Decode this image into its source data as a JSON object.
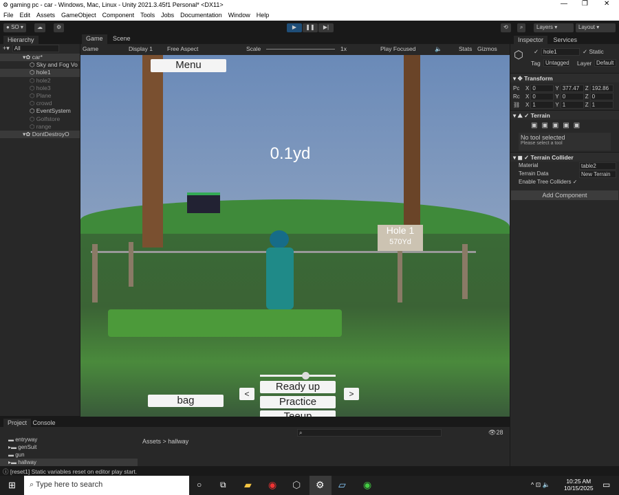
{
  "window": {
    "title": "gaming pc - car - Windows, Mac, Linux - Unity 2021.3.45f1 Personal* <DX11>",
    "controls": [
      "—",
      "❐",
      "✕"
    ]
  },
  "menu": [
    "File",
    "Edit",
    "Assets",
    "GameObject",
    "Component",
    "Tools",
    "Jobs",
    "Documentation",
    "Window",
    "Help"
  ],
  "toolbar": {
    "account": "SO",
    "layers": "Layers",
    "layout": "Layout"
  },
  "hierarchy": {
    "title": "Hierarchy",
    "search_placeholder": "All",
    "items": [
      {
        "label": "car*",
        "state": "scene"
      },
      {
        "label": "Sky and Fog Vo",
        "state": "normal"
      },
      {
        "label": "hole1",
        "state": "selected"
      },
      {
        "label": "hole2",
        "state": "inactive"
      },
      {
        "label": "hole3",
        "state": "inactive"
      },
      {
        "label": "Plane",
        "state": "inactive"
      },
      {
        "label": "crowd",
        "state": "inactive"
      },
      {
        "label": "EventSystem",
        "state": "normal"
      },
      {
        "label": "Golfstore",
        "state": "inactive"
      },
      {
        "label": "range",
        "state": "inactive"
      },
      {
        "label": "DontDestroyO",
        "state": "scene"
      }
    ]
  },
  "game_view": {
    "tabs": [
      "Game",
      "Scene"
    ],
    "mode": "Game",
    "display": "Display 1",
    "aspect": "Free Aspect",
    "scale_label": "Scale",
    "scale_value": "1x",
    "play_mode": "Play Focused",
    "stats": "Stats",
    "gizmos": "Gizmos"
  },
  "game_ui": {
    "menu_button": "Menu",
    "distance": "0.1yd",
    "sign_title": "Hole 1",
    "sign_yardage": "570Yd",
    "ready_button": "Ready up",
    "practice_button": "Practice",
    "teeup_button": "Teeup",
    "bag_button": "bag",
    "prev_button": "<",
    "next_button": ">",
    "power_slider": 0.6
  },
  "inspector": {
    "tabs": [
      "Inspector",
      "Services"
    ],
    "object_name": "hole1",
    "static_label": "Static",
    "tag_label": "Tag",
    "tag_value": "Untagged",
    "layer_label": "Layer",
    "layer_value": "Default",
    "transform": {
      "title": "Transform",
      "position": {
        "label": "Pc",
        "x": "0",
        "y": "377.47",
        "z": "192.86"
      },
      "rotation": {
        "label": "Rc",
        "x": "0",
        "y": "0",
        "z": "0"
      },
      "scale": {
        "x": "1",
        "y": "1",
        "z": "1"
      }
    },
    "terrain": {
      "title": "Terrain",
      "status": "No tool selected",
      "hint": "Please select a tool"
    },
    "terrain_collider": {
      "title": "Terrain Collider",
      "material_label": "Material",
      "material_value": "table2",
      "data_label": "Terrain Data",
      "data_value": "New Terrain",
      "trees_label": "Enable Tree Colliders"
    },
    "add_component": "Add Component"
  },
  "project": {
    "tabs": [
      "Project",
      "Console"
    ],
    "folders": [
      "entryway",
      "genSuit",
      "gun",
      "hallway"
    ],
    "breadcrumb": [
      "Assets",
      "hallway"
    ],
    "count": "28"
  },
  "status": {
    "message": "[reset1] Static variables reset on editor play start."
  },
  "taskbar": {
    "search_placeholder": "Type here to search",
    "time": "10:25 AM",
    "date": "10/15/2025"
  }
}
